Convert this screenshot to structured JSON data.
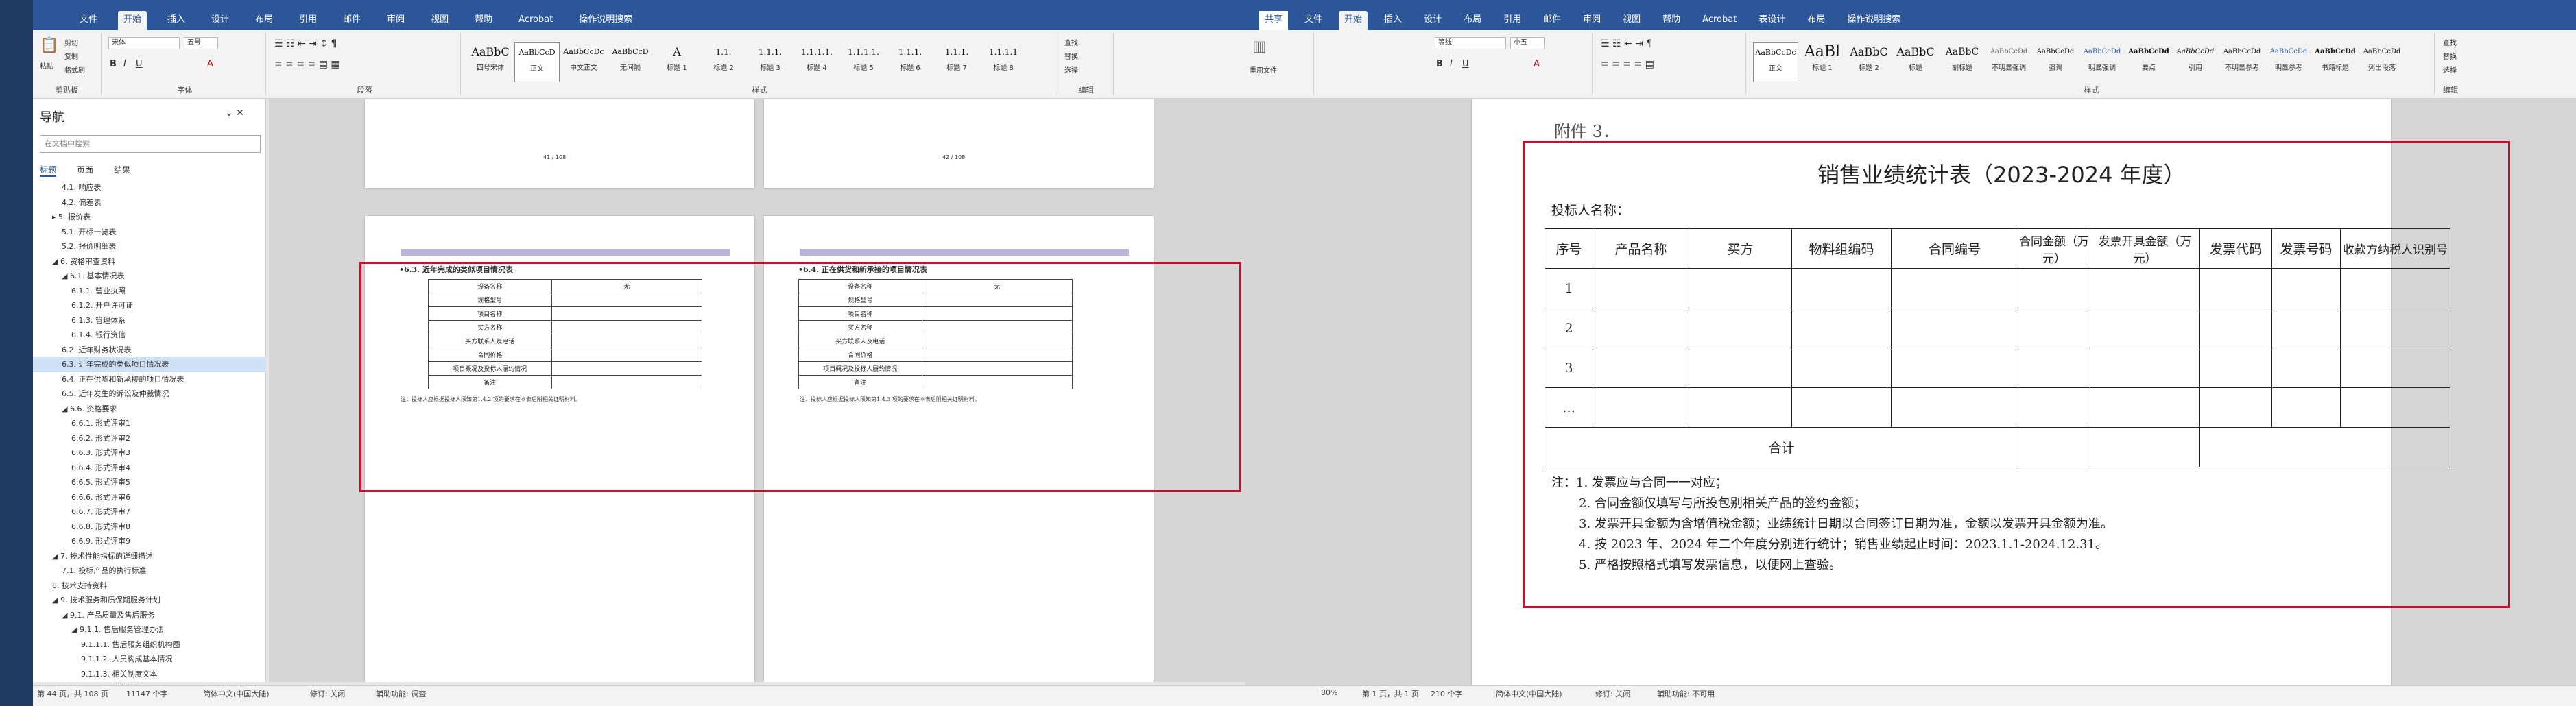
{
  "left_window": {
    "tabs": [
      "文件",
      "开始",
      "插入",
      "设计",
      "布局",
      "引用",
      "邮件",
      "审阅",
      "视图",
      "帮助",
      "Acrobat",
      "操作说明搜索"
    ],
    "active_tab": "开始",
    "ribbon": {
      "clipboard": {
        "label": "剪贴板",
        "paste": "粘贴",
        "cut": "剪切",
        "copy": "复制",
        "format_painter": "格式刷"
      },
      "font": {
        "label": "字体",
        "name": "宋体",
        "size": "五号"
      },
      "paragraph": {
        "label": "段落"
      },
      "styles": {
        "label": "样式",
        "items": [
          {
            "preview": "AaBbC",
            "name": "四号宋体"
          },
          {
            "preview": "AaBbCcD",
            "name": "正文"
          },
          {
            "preview": "AaBbCcDc",
            "name": "中文正文"
          },
          {
            "preview": "AaBbCcD",
            "name": "无间隔"
          },
          {
            "preview": "A",
            "name": "标题 1"
          },
          {
            "preview": "1.1.",
            "name": "标题 2"
          },
          {
            "preview": "1.1.1.",
            "name": "标题 3"
          },
          {
            "preview": "1.1.1.1.",
            "name": "标题 4"
          },
          {
            "preview": "1.1.1.1.",
            "name": "标题 5"
          },
          {
            "preview": "1.1.1.",
            "name": "标题 6"
          },
          {
            "preview": "1.1.1.",
            "name": "标题 7"
          },
          {
            "preview": "1.1.1.1",
            "name": "标题 8"
          }
        ]
      },
      "editing": {
        "label": "编辑",
        "find": "查找",
        "replace": "替换",
        "select": "选择"
      }
    },
    "nav": {
      "title": "导航",
      "search_placeholder": "在文档中搜索",
      "tabs": [
        "标题",
        "页面",
        "结果"
      ],
      "items": [
        "4.1. 响应表",
        "4.2. 偏差表",
        "▸ 5. 报价表",
        "5.1. 开标一览表",
        "5.2. 报价明细表",
        "◢ 6. 资格审查资料",
        "◢ 6.1. 基本情况表",
        "6.1.1. 营业执照",
        "6.1.2. 开户许可证",
        "6.1.3. 管理体系",
        "6.1.4. 银行资信",
        "6.2. 近年财务状况表",
        "6.3. 近年完成的类似项目情况表",
        "6.4. 正在供货和新承接的项目情况表",
        "6.5. 近年发生的诉讼及仲裁情况",
        "◢ 6.6. 资格要求",
        "6.6.1. 形式评审1",
        "6.6.2. 形式评审2",
        "6.6.3. 形式评审3",
        "6.6.4. 形式评审4",
        "6.6.5. 形式评审5",
        "6.6.6. 形式评审6",
        "6.6.7. 形式评审7",
        "6.6.8. 形式评审8",
        "6.6.9. 形式评审9",
        "◢ 7. 技术性能指标的详细描述",
        "7.1. 投标产品的执行标准",
        "8. 技术支持资料",
        "◢ 9. 技术服务和质保期服务计划",
        "◢ 9.1. 产品质量及售后服务",
        "◢ 9.1.1. 售后服务管理办法",
        "9.1.1.1. 售后服务组织机构图",
        "9.1.1.2. 人员构成基本情况",
        "9.1.1.3. 相关制度文本",
        "9.1.1.4. 服务流程"
      ],
      "selected_index": 12
    },
    "pages": {
      "top_page_left": "41 / 108",
      "top_page_right": "42 / 108",
      "left_heading": "•6.3. 近年完成的类似项目情况表",
      "right_heading": "•6.4. 正在供货和新承接的项目情况表",
      "left_rows": [
        [
          "设备名称",
          "无"
        ],
        [
          "规格型号",
          ""
        ],
        [
          "项目名称",
          ""
        ],
        [
          "买方名称",
          ""
        ],
        [
          "买方联系人及电话",
          ""
        ],
        [
          "合同价格",
          ""
        ],
        [
          "项目概况及投标人履约情况",
          ""
        ],
        [
          "备注",
          ""
        ]
      ],
      "right_rows": [
        [
          "设备名称",
          "无"
        ],
        [
          "规格型号",
          ""
        ],
        [
          "项目名称",
          ""
        ],
        [
          "买方名称",
          ""
        ],
        [
          "买方联系人及电话",
          ""
        ],
        [
          "合同价格",
          ""
        ],
        [
          "项目概况及投标人履约情况",
          ""
        ],
        [
          "备注",
          ""
        ]
      ],
      "left_note": "注：投标人应根据投标人须知第1.4.2 项的要求在本表后附相关证明材料。",
      "right_note": "注：投标人应根据投标人须知第1.4.3 项的要求在本表后附相关证明材料。"
    },
    "status": {
      "page": "第 44 页，共 108 页",
      "words": "11147 个字",
      "lang": "简体中文(中国大陆)",
      "track": "修订: 关闭",
      "accessibility": "辅助功能: 调查"
    }
  },
  "right_window": {
    "tabs": [
      "文件",
      "开始",
      "插入",
      "设计",
      "布局",
      "引用",
      "邮件",
      "审阅",
      "视图",
      "帮助",
      "Acrobat",
      "表设计",
      "布局",
      "操作说明搜索"
    ],
    "active_tab": "开始",
    "share": "共享",
    "ribbon": {
      "font": {
        "name": "等线",
        "size": "小五"
      },
      "styles": {
        "label": "样式",
        "items": [
          {
            "preview": "AaBbCcDc",
            "name": "正文"
          },
          {
            "preview": "AaBl",
            "name": "标题 1"
          },
          {
            "preview": "AaBbC",
            "name": "标题 2"
          },
          {
            "preview": "AaBbC",
            "name": "标题"
          },
          {
            "preview": "AaBbC",
            "name": "副标题"
          },
          {
            "preview": "AaBbCcDd",
            "name": "不明显强调"
          },
          {
            "preview": "AaBbCcDd",
            "name": "强调"
          },
          {
            "preview": "AaBbCcDd",
            "name": "明显强调"
          },
          {
            "preview": "AaBbCcDd",
            "name": "要点"
          },
          {
            "preview": "AaBbCcDd",
            "name": "引用"
          },
          {
            "preview": "AaBbCcDd",
            "name": "不明显参考"
          },
          {
            "preview": "AaBbCcDd",
            "name": "明显参考"
          },
          {
            "preview": "AaBbCcDd",
            "name": "书籍标题"
          },
          {
            "preview": "AaBbCcDd",
            "name": "列出段落"
          }
        ]
      },
      "editing": {
        "find": "查找",
        "replace": "替换",
        "select": "选择",
        "label": "编辑"
      },
      "reuse": "重用文件"
    },
    "doc": {
      "attachment": "附件 3．",
      "title": "销售业绩统计表（2023-2024 年度）",
      "bidder": "投标人名称：",
      "headers": [
        "序号",
        "产品名称",
        "买方",
        "物料组编码",
        "合同编号",
        "合同金额（万元）",
        "发票开具金额（万元）",
        "发票代码",
        "发票号码",
        "收款方纳税人识别号"
      ],
      "rows": [
        "1",
        "2",
        "3",
        "…"
      ],
      "total": "合计",
      "notes": [
        "注：1. 发票应与合同一一对应；",
        "2. 合同金额仅填写与所投包别相关产品的签约金额；",
        "3. 发票开具金额为含增值税金额；业绩统计日期以合同签订日期为准，金额以发票开具金额为准。",
        "4. 按 2023 年、2024 年二个年度分别进行统计；销售业绩起止时间：2023.1.1-2024.12.31。",
        "5. 严格按照格式填写发票信息，以便网上查验。"
      ]
    },
    "status": {
      "zoom": "80%",
      "page": "第 1 页，共 1 页",
      "words": "210 个字",
      "lang": "简体中文(中国大陆)",
      "track": "修订: 关闭",
      "accessibility": "辅助功能: 不可用"
    }
  },
  "colors": {
    "accent": "#2b579a",
    "highlight": "#c8102e"
  }
}
